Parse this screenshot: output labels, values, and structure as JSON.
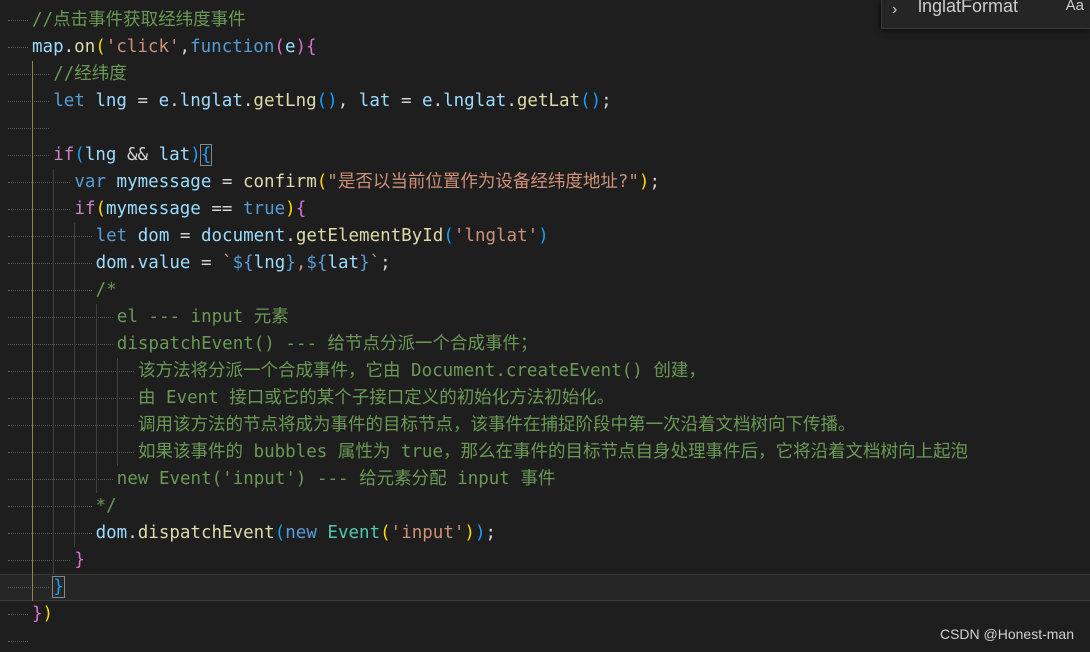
{
  "find_widget": {
    "toggle_icon": "chevron-right-icon",
    "toggle_glyph": "›",
    "query": "lnglatFormat",
    "match_case_label": "Aa"
  },
  "watermark": "CSDN @Honest-man",
  "colors": {
    "background": "#1e1e1e",
    "comment": "#6a9955",
    "keyword": "#569cd6",
    "control": "#c586c0",
    "function": "#dcdcaa",
    "variable": "#9cdcfe",
    "string": "#ce9178",
    "class": "#4ec9b0",
    "bracket_1": "#ffd700",
    "bracket_2": "#da70d6",
    "bracket_3": "#179fff"
  },
  "code": {
    "lines": [
      {
        "depth": 0,
        "current": false,
        "tokens": [
          {
            "t": "//点击事件获取经纬度事件",
            "c": "cmt"
          }
        ]
      },
      {
        "depth": 0,
        "current": false,
        "tokens": [
          {
            "t": "map",
            "c": "var"
          },
          {
            "t": ".",
            "c": "pun"
          },
          {
            "t": "on",
            "c": "fn"
          },
          {
            "t": "(",
            "c": "b1"
          },
          {
            "t": "'click'",
            "c": "str"
          },
          {
            "t": ",",
            "c": "pun"
          },
          {
            "t": "function",
            "c": "kw"
          },
          {
            "t": "(",
            "c": "b2"
          },
          {
            "t": "e",
            "c": "var"
          },
          {
            "t": ")",
            "c": "b2"
          },
          {
            "t": "{",
            "c": "b2"
          }
        ]
      },
      {
        "depth": 1,
        "current": false,
        "tokens": [
          {
            "t": "//经纬度",
            "c": "cmt"
          }
        ]
      },
      {
        "depth": 1,
        "current": false,
        "tokens": [
          {
            "t": "let",
            "c": "kw"
          },
          {
            "t": " ",
            "c": "pun"
          },
          {
            "t": "lng",
            "c": "var"
          },
          {
            "t": " = ",
            "c": "pun"
          },
          {
            "t": "e",
            "c": "var"
          },
          {
            "t": ".",
            "c": "pun"
          },
          {
            "t": "lnglat",
            "c": "var"
          },
          {
            "t": ".",
            "c": "pun"
          },
          {
            "t": "getLng",
            "c": "fn"
          },
          {
            "t": "()",
            "c": "b3"
          },
          {
            "t": ", ",
            "c": "pun"
          },
          {
            "t": "lat",
            "c": "var"
          },
          {
            "t": " = ",
            "c": "pun"
          },
          {
            "t": "e",
            "c": "var"
          },
          {
            "t": ".",
            "c": "pun"
          },
          {
            "t": "lnglat",
            "c": "var"
          },
          {
            "t": ".",
            "c": "pun"
          },
          {
            "t": "getLat",
            "c": "fn"
          },
          {
            "t": "()",
            "c": "b3"
          },
          {
            "t": ";",
            "c": "pun"
          }
        ]
      },
      {
        "depth": 1,
        "current": false,
        "tokens": []
      },
      {
        "depth": 1,
        "current": false,
        "tokens": [
          {
            "t": "if",
            "c": "ctl"
          },
          {
            "t": "(",
            "c": "b3"
          },
          {
            "t": "lng",
            "c": "var"
          },
          {
            "t": " && ",
            "c": "pun"
          },
          {
            "t": "lat",
            "c": "var"
          },
          {
            "t": ")",
            "c": "b3"
          },
          {
            "t": "{",
            "c": "b3",
            "hl": true
          }
        ]
      },
      {
        "depth": 2,
        "current": false,
        "tokens": [
          {
            "t": "var",
            "c": "kw"
          },
          {
            "t": " ",
            "c": "pun"
          },
          {
            "t": "mymessage",
            "c": "var"
          },
          {
            "t": " = ",
            "c": "pun"
          },
          {
            "t": "confirm",
            "c": "fn"
          },
          {
            "t": "(",
            "c": "b1"
          },
          {
            "t": "\"是否以当前位置作为设备经纬度地址?\"",
            "c": "str"
          },
          {
            "t": ")",
            "c": "b1"
          },
          {
            "t": ";",
            "c": "pun"
          }
        ]
      },
      {
        "depth": 2,
        "current": false,
        "tokens": [
          {
            "t": "if",
            "c": "ctl"
          },
          {
            "t": "(",
            "c": "b1"
          },
          {
            "t": "mymessage",
            "c": "var"
          },
          {
            "t": " == ",
            "c": "pun"
          },
          {
            "t": "true",
            "c": "kw"
          },
          {
            "t": ")",
            "c": "b1"
          },
          {
            "t": "{",
            "c": "b2"
          }
        ]
      },
      {
        "depth": 3,
        "current": false,
        "tokens": [
          {
            "t": "let",
            "c": "kw"
          },
          {
            "t": " ",
            "c": "pun"
          },
          {
            "t": "dom",
            "c": "var"
          },
          {
            "t": " = ",
            "c": "pun"
          },
          {
            "t": "document",
            "c": "var"
          },
          {
            "t": ".",
            "c": "pun"
          },
          {
            "t": "getElementById",
            "c": "fn"
          },
          {
            "t": "(",
            "c": "b3"
          },
          {
            "t": "'lnglat'",
            "c": "str"
          },
          {
            "t": ")",
            "c": "b3"
          }
        ]
      },
      {
        "depth": 3,
        "current": false,
        "tokens": [
          {
            "t": "dom",
            "c": "var"
          },
          {
            "t": ".",
            "c": "pun"
          },
          {
            "t": "value",
            "c": "var"
          },
          {
            "t": " = ",
            "c": "pun"
          },
          {
            "t": "`",
            "c": "str"
          },
          {
            "t": "${",
            "c": "kw"
          },
          {
            "t": "lng",
            "c": "var"
          },
          {
            "t": "}",
            "c": "kw"
          },
          {
            "t": ",",
            "c": "str"
          },
          {
            "t": "${",
            "c": "kw"
          },
          {
            "t": "lat",
            "c": "var"
          },
          {
            "t": "}",
            "c": "kw"
          },
          {
            "t": "`",
            "c": "str"
          },
          {
            "t": ";",
            "c": "pun"
          }
        ]
      },
      {
        "depth": 3,
        "current": false,
        "tokens": [
          {
            "t": "/*",
            "c": "cmt"
          }
        ]
      },
      {
        "depth": 4,
        "current": false,
        "tokens": [
          {
            "t": "el --- input 元素",
            "c": "cmt"
          }
        ]
      },
      {
        "depth": 4,
        "current": false,
        "tokens": [
          {
            "t": "dispatchEvent() --- 给节点分派一个合成事件；",
            "c": "cmt"
          }
        ]
      },
      {
        "depth": 5,
        "current": false,
        "tokens": [
          {
            "t": "该方法将分派一个合成事件，它由 Document.createEvent() 创建，",
            "c": "cmt"
          }
        ]
      },
      {
        "depth": 5,
        "current": false,
        "tokens": [
          {
            "t": "由 Event 接口或它的某个子接口定义的初始化方法初始化。",
            "c": "cmt"
          }
        ]
      },
      {
        "depth": 5,
        "current": false,
        "tokens": [
          {
            "t": "调用该方法的节点将成为事件的目标节点，该事件在捕捉阶段中第一次沿着文档树向下传播。",
            "c": "cmt"
          }
        ]
      },
      {
        "depth": 5,
        "current": false,
        "tokens": [
          {
            "t": "如果该事件的 bubbles 属性为 true，那么在事件的目标节点自身处理事件后，它将沿着文档树向上起泡",
            "c": "cmt"
          }
        ]
      },
      {
        "depth": 4,
        "current": false,
        "tokens": [
          {
            "t": "new Event('input') --- 给元素分配 input 事件",
            "c": "cmt"
          }
        ]
      },
      {
        "depth": 3,
        "current": false,
        "tokens": [
          {
            "t": "*/",
            "c": "cmt"
          }
        ]
      },
      {
        "depth": 3,
        "current": false,
        "tokens": [
          {
            "t": "dom",
            "c": "var"
          },
          {
            "t": ".",
            "c": "pun"
          },
          {
            "t": "dispatchEvent",
            "c": "fn"
          },
          {
            "t": "(",
            "c": "b3"
          },
          {
            "t": "new",
            "c": "kw"
          },
          {
            "t": " ",
            "c": "pun"
          },
          {
            "t": "Event",
            "c": "cls"
          },
          {
            "t": "(",
            "c": "b1"
          },
          {
            "t": "'input'",
            "c": "str"
          },
          {
            "t": ")",
            "c": "b1"
          },
          {
            "t": ")",
            "c": "b3"
          },
          {
            "t": ";",
            "c": "pun"
          }
        ]
      },
      {
        "depth": 2,
        "current": false,
        "tokens": [
          {
            "t": "}",
            "c": "b2"
          }
        ]
      },
      {
        "depth": 1,
        "current": true,
        "tokens": [
          {
            "t": "}",
            "c": "b3",
            "hl": true
          }
        ]
      },
      {
        "depth": 0,
        "current": false,
        "tokens": [
          {
            "t": "}",
            "c": "b2"
          },
          {
            "t": ")",
            "c": "b1"
          }
        ]
      },
      {
        "depth": 0,
        "current": false,
        "tokens": []
      }
    ]
  }
}
